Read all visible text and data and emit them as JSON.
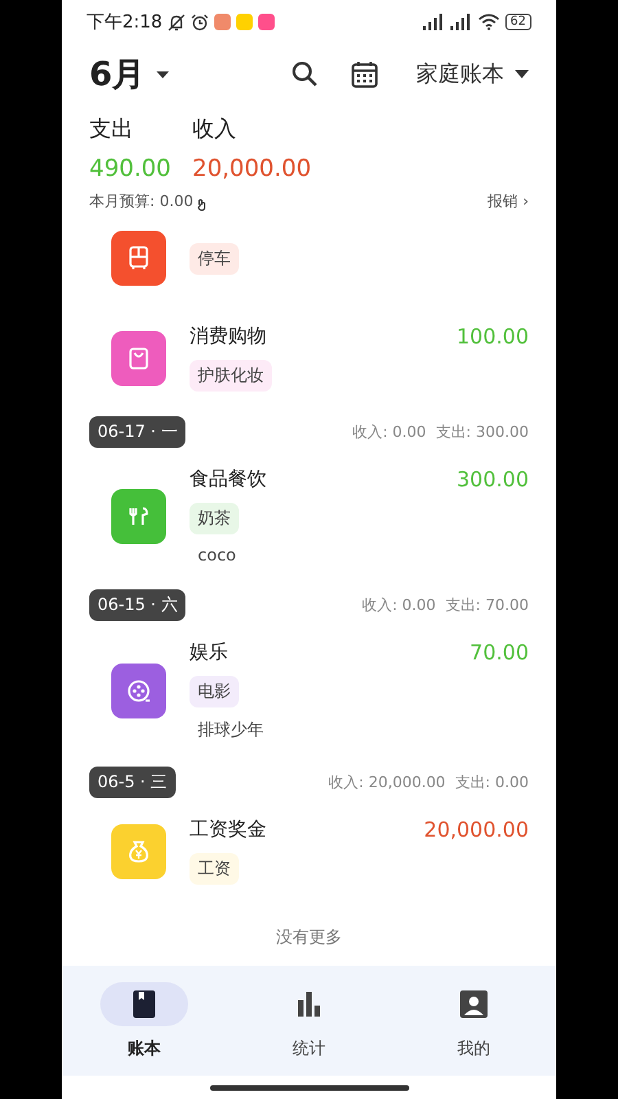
{
  "status_bar": {
    "time": "下午2:18",
    "battery": "62"
  },
  "header": {
    "month": "6月",
    "book": "家庭账本"
  },
  "summary": {
    "expense_label": "支出",
    "income_label": "收入",
    "expense": "490.00",
    "income": "20,000.00",
    "budget": "本月预算: 0.00",
    "reimburse": "报销 ›"
  },
  "groups": [
    {
      "items": [
        {
          "kind": "transport",
          "color": "#f4502e",
          "tag": "停车"
        },
        {
          "kind": "shopping",
          "color": "#ee5cbd",
          "income": false,
          "category": "消费购物",
          "amount": "100.00",
          "tag": "护肤化妆"
        }
      ]
    },
    {
      "date": "06-17 · 一",
      "totals": "收入: 0.00  支出: 300.00",
      "items": [
        {
          "kind": "food",
          "color": "#45bf3a",
          "income": false,
          "category": "食品餐饮",
          "amount": "300.00",
          "tag": "奶茶",
          "note": "coco"
        }
      ]
    },
    {
      "date": "06-15 · 六",
      "totals": "收入: 0.00  支出: 70.00",
      "items": [
        {
          "kind": "movie",
          "color": "#9c5fe0",
          "income": false,
          "category": "娱乐",
          "amount": "70.00",
          "tag": "电影",
          "note": "排球少年"
        }
      ]
    },
    {
      "date": "06-5 · 三",
      "totals": "收入: 20,000.00  支出: 0.00",
      "items": [
        {
          "kind": "salary",
          "color": "#fbd12f",
          "income": true,
          "category": "工资奖金",
          "amount": "20,000.00",
          "tag": "工资"
        }
      ]
    }
  ],
  "end_text": "没有更多",
  "nav": [
    {
      "label": "账本",
      "kind": "book",
      "selected": true
    },
    {
      "label": "统计",
      "kind": "stats",
      "selected": false
    },
    {
      "label": "我的",
      "kind": "profile",
      "selected": false
    }
  ]
}
